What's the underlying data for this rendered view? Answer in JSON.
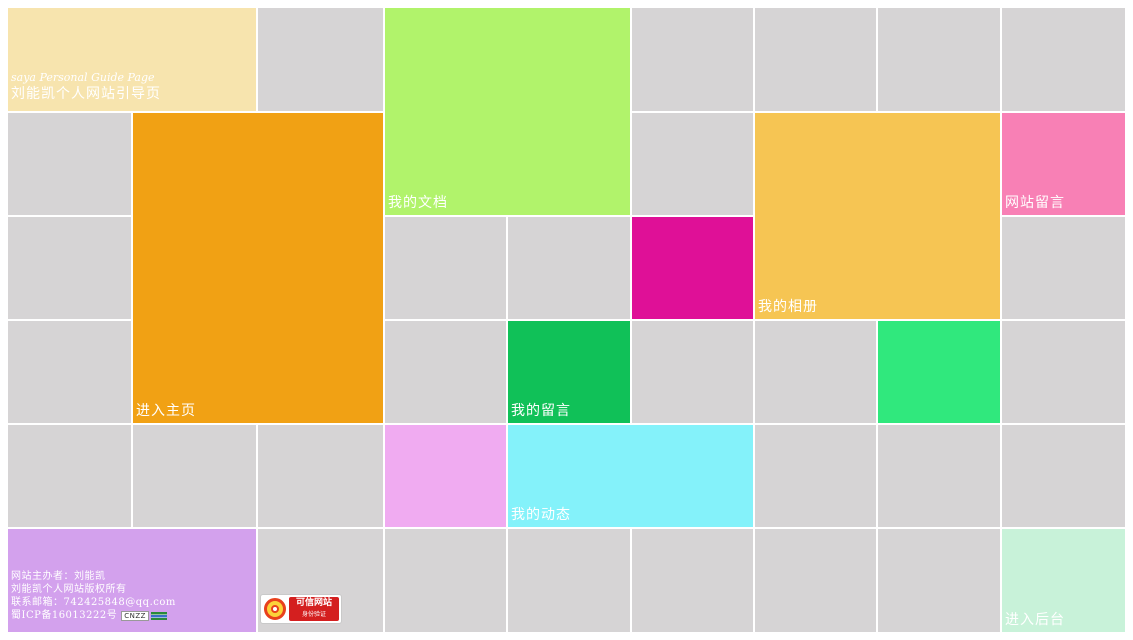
{
  "header": {
    "title_en": "saya Personal Guide Page",
    "title_cn": "刘能凯个人网站引导页"
  },
  "nav": {
    "home": "进入主页",
    "docs": "我的文档",
    "album": "我的相册",
    "site_message": "网站留言",
    "my_message": "我的留言",
    "activity": "我的动态",
    "admin": "进入后台"
  },
  "footer": {
    "owner": "网站主办者：刘能凯",
    "copyright": "刘能凯个人网站版权所有",
    "email": "联系邮箱：742425848@qq.com",
    "icp": "蜀ICP备16013222号",
    "cnzz": "CNZZ"
  },
  "trust_badge": {
    "title": "可信网站",
    "subtitle": "身份验证"
  },
  "colors": {
    "tile_gray": "#d6d4d5",
    "header": "#f7e4ae",
    "home": "#f1a114",
    "docs": "#b1f36b",
    "album": "#f6c553",
    "site_message": "#f880b5",
    "magenta": "#df1097",
    "my_message": "#10c158",
    "green_light": "#30e87d",
    "pink": "#f0abf1",
    "activity": "#84f2fa",
    "footer": "#d3a1ed",
    "admin": "#c8f2d9"
  }
}
